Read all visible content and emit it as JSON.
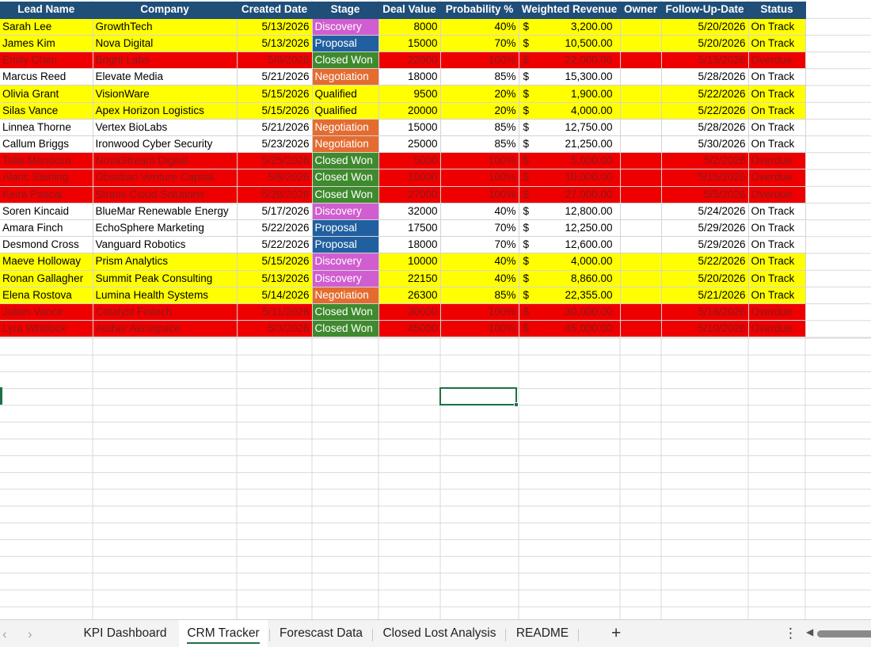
{
  "sheet": {
    "headers": [
      "Lead Name",
      "Company",
      "Created Date",
      "Stage",
      "Deal Value",
      "Probability %",
      "Weighted Revenue",
      "Owner",
      "Follow-Up-Date",
      "Status"
    ],
    "currency_symbol": "$",
    "rows": [
      {
        "lead": "Sarah Lee",
        "company": "GrowthTech",
        "created": "5/13/2026",
        "stage": "Discovery",
        "value": "8000",
        "prob": "40%",
        "weighted": "3,200.00",
        "owner": "",
        "followup": "5/20/2026",
        "status": "On Track",
        "row_color": "yellow"
      },
      {
        "lead": "James Kim",
        "company": "Nova Digital",
        "created": "5/13/2026",
        "stage": "Proposal",
        "value": "15000",
        "prob": "70%",
        "weighted": "10,500.00",
        "owner": "",
        "followup": "5/20/2026",
        "status": "On Track",
        "row_color": "yellow"
      },
      {
        "lead": "Emily Chen",
        "company": "Bright Labs",
        "created": "5/8/2026",
        "stage": "Closed Won",
        "value": "22000",
        "prob": "100%",
        "weighted": "22,000.00",
        "owner": "",
        "followup": "5/15/2026",
        "status": "Overdue",
        "row_color": "red"
      },
      {
        "lead": "Marcus Reed",
        "company": "Elevate Media",
        "created": "5/21/2026",
        "stage": "Negotiation",
        "value": "18000",
        "prob": "85%",
        "weighted": "15,300.00",
        "owner": "",
        "followup": "5/28/2026",
        "status": "On Track",
        "row_color": "white"
      },
      {
        "lead": "Olivia Grant",
        "company": "VisionWare",
        "created": "5/15/2026",
        "stage": "Qualified",
        "value": "9500",
        "prob": "20%",
        "weighted": "1,900.00",
        "owner": "",
        "followup": "5/22/2026",
        "status": "On Track",
        "row_color": "yellow"
      },
      {
        "lead": "Silas Vance",
        "company": "Apex Horizon Logistics",
        "created": "5/15/2026",
        "stage": "Qualified",
        "value": "20000",
        "prob": "20%",
        "weighted": "4,000.00",
        "owner": "",
        "followup": "5/22/2026",
        "status": "On Track",
        "row_color": "yellow"
      },
      {
        "lead": "Linnea Thorne",
        "company": "Vertex BioLabs",
        "created": "5/21/2026",
        "stage": "Negotiation",
        "value": "15000",
        "prob": "85%",
        "weighted": "12,750.00",
        "owner": "",
        "followup": "5/28/2026",
        "status": "On Track",
        "row_color": "white"
      },
      {
        "lead": "Callum Briggs",
        "company": "Ironwood Cyber Security",
        "created": "5/23/2026",
        "stage": "Negotiation",
        "value": "25000",
        "prob": "85%",
        "weighted": "21,250.00",
        "owner": "",
        "followup": "5/30/2026",
        "status": "On Track",
        "row_color": "white"
      },
      {
        "lead": "Talia Mendoza",
        "company": "NovaStream Digital",
        "created": "5/25/2026",
        "stage": "Closed Won",
        "value": "5000",
        "prob": "100%",
        "weighted": "5,000.00",
        "owner": "",
        "followup": "5/2/2026",
        "status": "Overdue",
        "row_color": "red"
      },
      {
        "lead": "Alaric Sterling",
        "company": "Obsidian Venture Capital",
        "created": "5/8/2026",
        "stage": "Closed Won",
        "value": "10000",
        "prob": "100%",
        "weighted": "10,000.00",
        "owner": "",
        "followup": "5/15/2026",
        "status": "Overdue",
        "row_color": "red"
      },
      {
        "lead": "Keira Pascal",
        "company": "Straos Cloud Solutions",
        "created": "5/28/2026",
        "stage": "Closed Won",
        "value": "27000",
        "prob": "100%",
        "weighted": "27,000.00",
        "owner": "",
        "followup": "5/5/2026",
        "status": "Overdue",
        "row_color": "red"
      },
      {
        "lead": "Soren Kincaid",
        "company": "BlueMar Renewable Energy",
        "created": "5/17/2026",
        "stage": "Discovery",
        "value": "32000",
        "prob": "40%",
        "weighted": "12,800.00",
        "owner": "",
        "followup": "5/24/2026",
        "status": "On Track",
        "row_color": "white"
      },
      {
        "lead": "Amara Finch",
        "company": "EchoSphere Marketing",
        "created": "5/22/2026",
        "stage": "Proposal",
        "value": "17500",
        "prob": "70%",
        "weighted": "12,250.00",
        "owner": "",
        "followup": "5/29/2026",
        "status": "On Track",
        "row_color": "white"
      },
      {
        "lead": "Desmond Cross",
        "company": "Vanguard Robotics",
        "created": "5/22/2026",
        "stage": "Proposal",
        "value": "18000",
        "prob": "70%",
        "weighted": "12,600.00",
        "owner": "",
        "followup": "5/29/2026",
        "status": "On Track",
        "row_color": "white"
      },
      {
        "lead": "Maeve Holloway",
        "company": "Prism Analytics",
        "created": "5/15/2026",
        "stage": "Discovery",
        "value": "10000",
        "prob": "40%",
        "weighted": "4,000.00",
        "owner": "",
        "followup": "5/22/2026",
        "status": "On Track",
        "row_color": "yellow"
      },
      {
        "lead": "Ronan Gallagher",
        "company": "Summit Peak Consulting",
        "created": "5/13/2026",
        "stage": "Discovery",
        "value": "22150",
        "prob": "40%",
        "weighted": "8,860.00",
        "owner": "",
        "followup": "5/20/2026",
        "status": "On Track",
        "row_color": "yellow"
      },
      {
        "lead": "Elena Rostova",
        "company": "Lumina Health Systems",
        "created": "5/14/2026",
        "stage": "Negotiation",
        "value": "26300",
        "prob": "85%",
        "weighted": "22,355.00",
        "owner": "",
        "followup": "5/21/2026",
        "status": "On Track",
        "row_color": "yellow"
      },
      {
        "lead": "Julian Vance",
        "company": "Catalyst Fintech",
        "created": "5/11/2026",
        "stage": "Closed Won",
        "value": "30000",
        "prob": "100%",
        "weighted": "30,000.00",
        "owner": "",
        "followup": "5/18/2026",
        "status": "Overdue",
        "row_color": "red"
      },
      {
        "lead": "Lyra Whitlock",
        "company": "Aether Aerospace",
        "created": "5/3/2026",
        "stage": "Closed Won",
        "value": "45000",
        "prob": "100%",
        "weighted": "45,000.00",
        "owner": "",
        "followup": "5/10/2026",
        "status": "Overdue",
        "row_color": "red"
      }
    ]
  },
  "tabs": {
    "nav_prev": "‹",
    "nav_next": "›",
    "items": [
      "KPI Dashboard",
      "CRM Tracker",
      "Forescast Data",
      "Closed Lost Analysis",
      "README"
    ],
    "active": "CRM Tracker",
    "add": "+",
    "more": "⋮",
    "scroll_left": "◀"
  },
  "colors": {
    "header_bg": "#1f4e79",
    "row_yellow": "#ffff00",
    "row_red": "#ee0000",
    "stage_discovery": "#d05ed0",
    "stage_proposal": "#2160a0",
    "stage_closed_won": "#3f8a2e",
    "stage_negotiation": "#e46c31",
    "selection": "#1e7145"
  }
}
